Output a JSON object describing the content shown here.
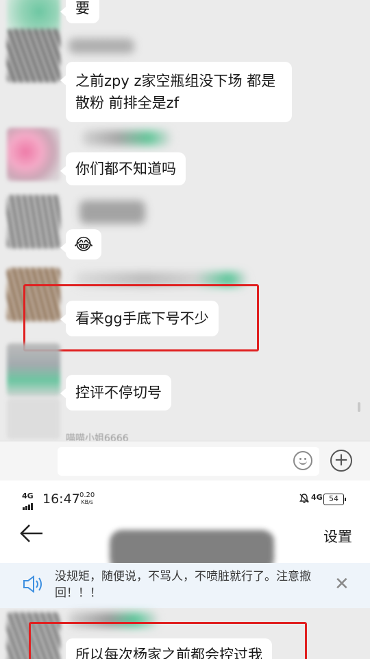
{
  "chat": {
    "messages": [
      {
        "text": "要"
      },
      {
        "text": "之前zpy z家空瓶组没下场 都是散粉 前排全是zf"
      },
      {
        "text": "你们都不知道吗"
      },
      {
        "text": "😂"
      },
      {
        "text": "看来gg手底下号不少",
        "highlighted": true
      },
      {
        "text": "控评不停切号"
      }
    ],
    "partial_nickname": "喵喵小姐6666"
  },
  "status_bar": {
    "signal": "4G",
    "time": "16:47",
    "speed_value": "0.20",
    "speed_unit": "KB/s",
    "network": "4G",
    "battery": "54"
  },
  "header": {
    "back_icon": "back-arrow-icon",
    "settings_label": "设置"
  },
  "notice": {
    "text": "没规矩，随便说，不骂人，不喷脏就行了。注意撤回！！！"
  },
  "chat2": {
    "message": "所以每次杨家之前都会控过我",
    "highlighted": true
  },
  "colors": {
    "highlight_box": "#e02020",
    "chat_background": "#ebebeb",
    "notice_background": "#eef4fa"
  }
}
